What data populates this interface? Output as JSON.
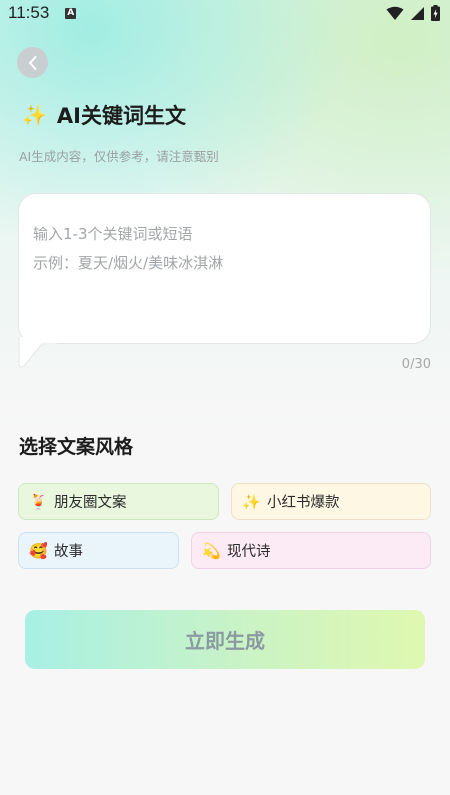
{
  "status_bar": {
    "time": "11:53",
    "notification_glyph": "A",
    "icons": [
      "wifi-icon",
      "signal-icon",
      "battery-icon"
    ]
  },
  "header": {
    "back_icon": "chevron-left-icon",
    "title_icon": "sparkles-icon",
    "title_icon_glyph": "✨",
    "title": "AI关键词生文",
    "subtitle": "AI生成内容，仅供参考，请注意甄别"
  },
  "input": {
    "placeholder_line1": "输入1-3个关键词或短语",
    "placeholder_line2": "示例：夏天/烟火/美味冰淇淋",
    "counter": "0/30"
  },
  "styles": {
    "section_title": "选择文案风格",
    "options": [
      {
        "emoji": "🍹",
        "label": "朋友圈文案"
      },
      {
        "emoji": "✨",
        "label": "小红书爆款"
      },
      {
        "emoji": "🥰",
        "label": "故事"
      },
      {
        "emoji": "💫",
        "label": "现代诗"
      }
    ]
  },
  "actions": {
    "generate_label": "立即生成"
  },
  "colors": {
    "accent_start": "#a8f0e4",
    "accent_end": "#dff8b0",
    "chip_green": "#e8f7de",
    "chip_yellow": "#fdf7e4",
    "chip_blue": "#e9f4fb",
    "chip_pink": "#fcebf5"
  }
}
